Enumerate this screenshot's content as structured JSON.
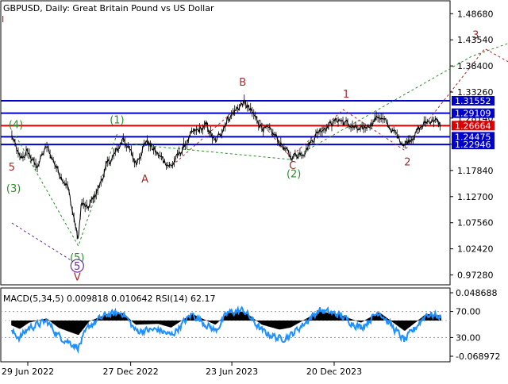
{
  "header": {
    "symbol_info": "GBPUSD, Daily:  Great Britain Pound vs US Dollar",
    "corner_label": "I",
    "indicator_info": "MACD(5,34,5) 0.009818 0.010642 RSI(14) 62.17"
  },
  "colors": {
    "background": "#ffffff",
    "price_line": "#000000",
    "resistance_support": "#0000cc",
    "pivot_level": "#dd0000",
    "wave_green": "#2e8b2e",
    "wave_red": "#a52a2a",
    "wave_purple": "#6a2d9f",
    "macd_hist": "#000000",
    "rsi_line": "#1e90ff",
    "level_label_bg": "#0000cc",
    "pivot_label_bg": "#dd0000"
  },
  "chart_data": [
    {
      "type": "line",
      "title": "GBPUSD, Daily:  Great Britain Pound vs US Dollar",
      "ylim": [
        0.955,
        1.495
      ],
      "y_ticks": [
        "1.48680",
        "1.43540",
        "1.38400",
        "1.33260",
        "1.28140",
        "1.23000",
        "1.17840",
        "1.12700",
        "1.07560",
        "1.02420",
        "0.97280"
      ],
      "x_ticks": [
        "29 Jun 2022",
        "27 Dec 2022",
        "23 Jun 2023",
        "20 Dec 2023"
      ],
      "price_anchors": [
        {
          "d": "2022-06-01",
          "v": 1.246
        },
        {
          "d": "2022-06-15",
          "v": 1.2
        },
        {
          "d": "2022-06-29",
          "v": 1.215
        },
        {
          "d": "2022-07-14",
          "v": 1.185
        },
        {
          "d": "2022-08-01",
          "v": 1.225
        },
        {
          "d": "2022-08-23",
          "v": 1.175
        },
        {
          "d": "2022-09-07",
          "v": 1.148
        },
        {
          "d": "2022-09-26",
          "v": 1.04
        },
        {
          "d": "2022-10-01",
          "v": 1.115
        },
        {
          "d": "2022-10-12",
          "v": 1.102
        },
        {
          "d": "2022-11-01",
          "v": 1.145
        },
        {
          "d": "2022-11-15",
          "v": 1.188
        },
        {
          "d": "2022-12-06",
          "v": 1.222
        },
        {
          "d": "2022-12-14",
          "v": 1.244
        },
        {
          "d": "2023-01-05",
          "v": 1.192
        },
        {
          "d": "2023-01-23",
          "v": 1.238
        },
        {
          "d": "2023-02-14",
          "v": 1.208
        },
        {
          "d": "2023-03-08",
          "v": 1.186
        },
        {
          "d": "2023-04-14",
          "v": 1.25
        },
        {
          "d": "2023-05-10",
          "v": 1.266
        },
        {
          "d": "2023-05-25",
          "v": 1.232
        },
        {
          "d": "2023-06-16",
          "v": 1.281
        },
        {
          "d": "2023-07-14",
          "v": 1.313
        },
        {
          "d": "2023-08-15",
          "v": 1.265
        },
        {
          "d": "2023-09-08",
          "v": 1.246
        },
        {
          "d": "2023-10-04",
          "v": 1.205
        },
        {
          "d": "2023-10-27",
          "v": 1.215
        },
        {
          "d": "2023-11-24",
          "v": 1.258
        },
        {
          "d": "2023-12-28",
          "v": 1.279
        },
        {
          "d": "2024-02-05",
          "v": 1.255
        },
        {
          "d": "2024-03-08",
          "v": 1.286
        },
        {
          "d": "2024-04-22",
          "v": 1.23
        },
        {
          "d": "2024-05-30",
          "v": 1.274
        },
        {
          "d": "2024-06-12",
          "v": 1.279
        },
        {
          "d": "2024-06-25",
          "v": 1.266
        }
      ],
      "horizontal_levels": [
        {
          "label": "1.31552",
          "value": 1.31552,
          "role": "resistance"
        },
        {
          "label": "1.29109",
          "value": 1.29109,
          "role": "resistance"
        },
        {
          "label": "1.26664",
          "value": 1.26664,
          "role": "pivot"
        },
        {
          "label": "1.24475",
          "value": 1.24475,
          "role": "support"
        },
        {
          "label": "1.22946",
          "value": 1.22946,
          "role": "support"
        }
      ],
      "wave_labels": [
        {
          "text": "(4)",
          "d": "2022-06-08",
          "v": 1.262,
          "color": "green"
        },
        {
          "text": "5",
          "d": "2022-06-01",
          "v": 1.178,
          "color": "red"
        },
        {
          "text": "(3)",
          "d": "2022-06-04",
          "v": 1.136,
          "color": "green"
        },
        {
          "text": "(1)",
          "d": "2022-12-03",
          "v": 1.271,
          "color": "green"
        },
        {
          "text": "A",
          "d": "2023-01-21",
          "v": 1.155,
          "color": "red"
        },
        {
          "text": "B",
          "d": "2023-07-12",
          "v": 1.345,
          "color": "red"
        },
        {
          "text": "C",
          "d": "2023-10-08",
          "v": 1.181,
          "color": "red"
        },
        {
          "text": "(2)",
          "d": "2023-10-10",
          "v": 1.165,
          "color": "green"
        },
        {
          "text": "1",
          "d": "2024-01-10",
          "v": 1.322,
          "color": "red"
        },
        {
          "text": "2",
          "d": "2024-04-27",
          "v": 1.188,
          "color": "red"
        },
        {
          "text": "3",
          "d": "2024-08-25",
          "v": 1.438,
          "color": "red"
        },
        {
          "text": "(5)",
          "d": "2022-09-24",
          "v": 1.0,
          "color": "green"
        },
        {
          "text": "5",
          "d": "2022-09-24",
          "v": 0.983,
          "color": "purple"
        },
        {
          "text": "V",
          "d": "2022-09-24",
          "v": 0.962,
          "color": "red"
        }
      ],
      "dashed_lines": [
        {
          "color": "green",
          "points": [
            {
              "d": "2022-06-08",
              "v": 1.246
            },
            {
              "d": "2022-09-26",
              "v": 1.03
            },
            {
              "d": "2022-12-03",
              "v": 1.25
            }
          ]
        },
        {
          "color": "green",
          "points": [
            {
              "d": "2022-12-10",
              "v": 1.232
            },
            {
              "d": "2023-10-04",
              "v": 1.2
            },
            {
              "d": "2024-08-18",
              "v": 1.403
            },
            {
              "d": "2024-12-20",
              "v": 1.452
            }
          ]
        },
        {
          "color": "red",
          "points": [
            {
              "d": "2023-03-10",
              "v": 1.188
            },
            {
              "d": "2023-07-14",
              "v": 1.313
            },
            {
              "d": "2023-10-04",
              "v": 1.205
            },
            {
              "d": "2024-01-05",
              "v": 1.298
            },
            {
              "d": "2024-04-22",
              "v": 1.218
            },
            {
              "d": "2024-09-10",
              "v": 1.418
            },
            {
              "d": "2024-11-05",
              "v": 1.383
            }
          ]
        },
        {
          "color": "purple",
          "points": [
            {
              "d": "2022-06-01",
              "v": 1.075
            },
            {
              "d": "2022-09-24",
              "v": 0.994
            }
          ]
        }
      ]
    },
    {
      "type": "bar",
      "title": "MACD(5,34,5) 0.009818 0.010642 RSI(14) 62.17",
      "series": [
        {
          "name": "MACD",
          "last": 0.009818
        },
        {
          "name": "RSI(14)",
          "last": 62.17
        }
      ],
      "macd_ylim": [
        -0.068972,
        0.048688
      ],
      "macd_ticks": [
        "0.048688",
        "-0.068972"
      ],
      "rsi_levels": [
        70,
        30
      ],
      "rsi_ticks": [
        "70.00",
        "30.00"
      ],
      "rsi_anchors": [
        {
          "d": "2022-06-01",
          "v": 38
        },
        {
          "d": "2022-06-15",
          "v": 30
        },
        {
          "d": "2022-07-01",
          "v": 45
        },
        {
          "d": "2022-08-01",
          "v": 55
        },
        {
          "d": "2022-08-23",
          "v": 32
        },
        {
          "d": "2022-09-26",
          "v": 15
        },
        {
          "d": "2022-10-15",
          "v": 48
        },
        {
          "d": "2022-11-15",
          "v": 65
        },
        {
          "d": "2022-12-14",
          "v": 68
        },
        {
          "d": "2023-01-05",
          "v": 40
        },
        {
          "d": "2023-02-14",
          "v": 42
        },
        {
          "d": "2023-03-08",
          "v": 33
        },
        {
          "d": "2023-04-14",
          "v": 66
        },
        {
          "d": "2023-05-25",
          "v": 40
        },
        {
          "d": "2023-06-16",
          "v": 68
        },
        {
          "d": "2023-07-14",
          "v": 72
        },
        {
          "d": "2023-08-15",
          "v": 40
        },
        {
          "d": "2023-09-15",
          "v": 28
        },
        {
          "d": "2023-10-04",
          "v": 33
        },
        {
          "d": "2023-11-24",
          "v": 72
        },
        {
          "d": "2023-12-28",
          "v": 65
        },
        {
          "d": "2024-02-05",
          "v": 45
        },
        {
          "d": "2024-03-08",
          "v": 70
        },
        {
          "d": "2024-04-22",
          "v": 25
        },
        {
          "d": "2024-05-30",
          "v": 66
        },
        {
          "d": "2024-06-25",
          "v": 62
        }
      ]
    }
  ]
}
